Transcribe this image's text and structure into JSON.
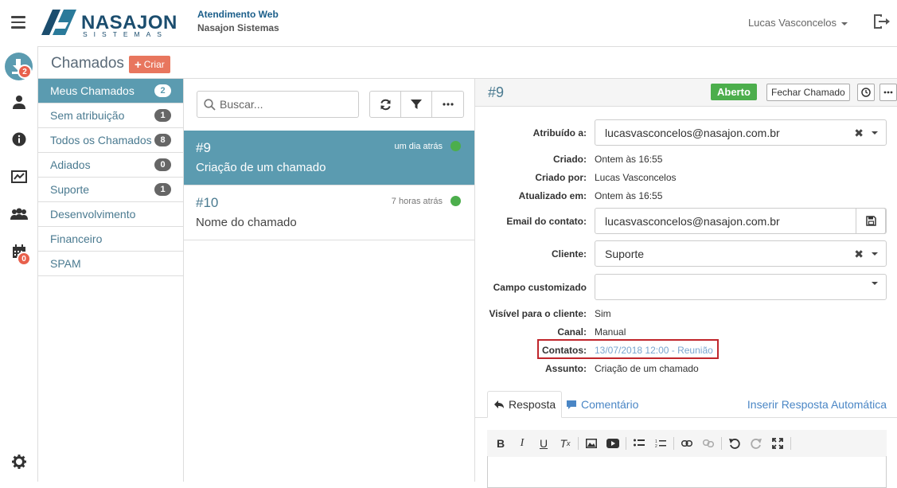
{
  "header": {
    "app_name": "Atendimento Web",
    "company": "Nasajon Sistemas",
    "logo_text": "NASAJON",
    "logo_sub": "SISTEMAS",
    "user_name": "Lucas Vasconcelos"
  },
  "rail": {
    "inbox_badge": "2",
    "calendar_badge": "0",
    "accent": "#5b9bb0",
    "badge_color": "#e8604c"
  },
  "page": {
    "title": "Chamados",
    "create_label": "Criar"
  },
  "filters": [
    {
      "label": "Meus Chamados",
      "count": "2"
    },
    {
      "label": "Sem atribuição",
      "count": "1"
    },
    {
      "label": "Todos os Chamados",
      "count": "8"
    },
    {
      "label": "Adiados",
      "count": "0"
    },
    {
      "label": "Suporte",
      "count": "1"
    },
    {
      "label": "Desenvolvimento",
      "count": ""
    },
    {
      "label": "Financeiro",
      "count": ""
    },
    {
      "label": "SPAM",
      "count": ""
    }
  ],
  "list": {
    "search_placeholder": "Buscar...",
    "tickets": [
      {
        "id": "#9",
        "title": "Criação de um chamado",
        "time": "um dia atrás",
        "status_color": "#4cae4c"
      },
      {
        "id": "#10",
        "title": "Nome do chamado",
        "time": "7 horas atrás",
        "status_color": "#4cae4c"
      }
    ]
  },
  "detail": {
    "id": "#9",
    "status": "Aberto",
    "close_label": "Fechar Chamado",
    "fields": {
      "assigned_label": "Atribuído a:",
      "assigned_value": "lucasvasconcelos@nasajon.com.br",
      "created_label": "Criado:",
      "created_value": "Ontem às 16:55",
      "created_by_label": "Criado por:",
      "created_by_value": "Lucas Vasconcelos",
      "updated_label": "Atualizado em:",
      "updated_value": "Ontem às 16:55",
      "email_label": "Email do contato:",
      "email_value": "lucasvasconcelos@nasajon.com.br",
      "client_label": "Cliente:",
      "client_value": "Suporte",
      "custom_label": "Campo customizado",
      "custom_value": "",
      "visible_label": "Visível para o cliente:",
      "visible_value": "Sim",
      "channel_label": "Canal:",
      "channel_value": "Manual",
      "contacts_label": "Contatos:",
      "contacts_value": "13/07/2018 12:00 - Reunião",
      "subject_label": "Assunto:",
      "subject_value": "Criação de um chamado"
    },
    "tabs": {
      "reply": "Resposta",
      "comment": "Comentário",
      "auto_reply": "Inserir Resposta Automática"
    }
  }
}
